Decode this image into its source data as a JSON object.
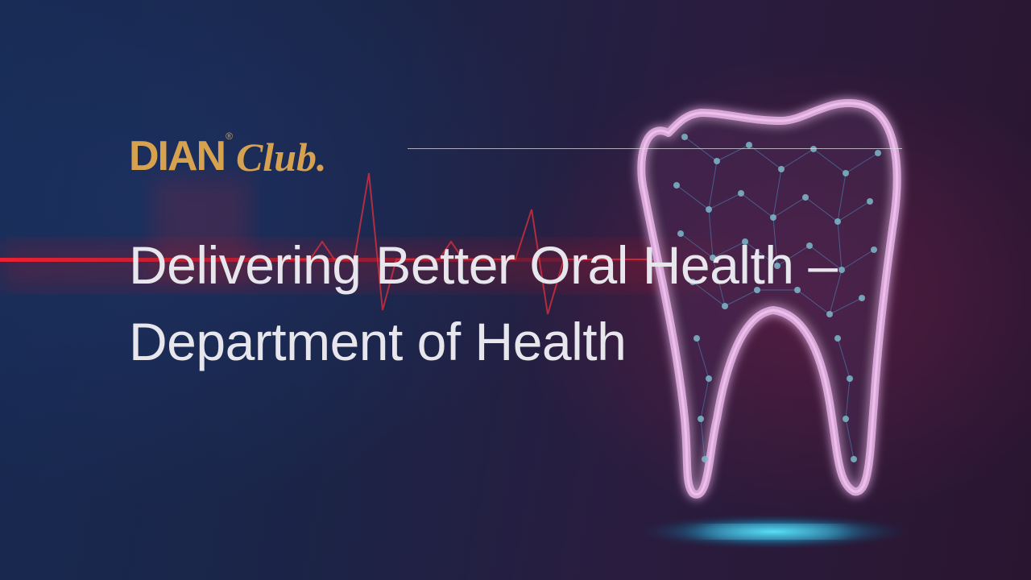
{
  "slide": {
    "logo": {
      "brand": "DIAN",
      "registered_mark": "®",
      "suffix": "Club."
    },
    "title": "Delivering Better Oral Health – Department of Health"
  },
  "colors": {
    "logo_gold": "#d7a24f",
    "title_text": "#e6e6ec",
    "tooth_glow": "#e58ad6",
    "heartbeat": "#d11f2a",
    "floor_glow": "#2fd0ff"
  },
  "icons": {
    "tooth": "tooth-icon",
    "heartbeat": "heartbeat-line"
  }
}
